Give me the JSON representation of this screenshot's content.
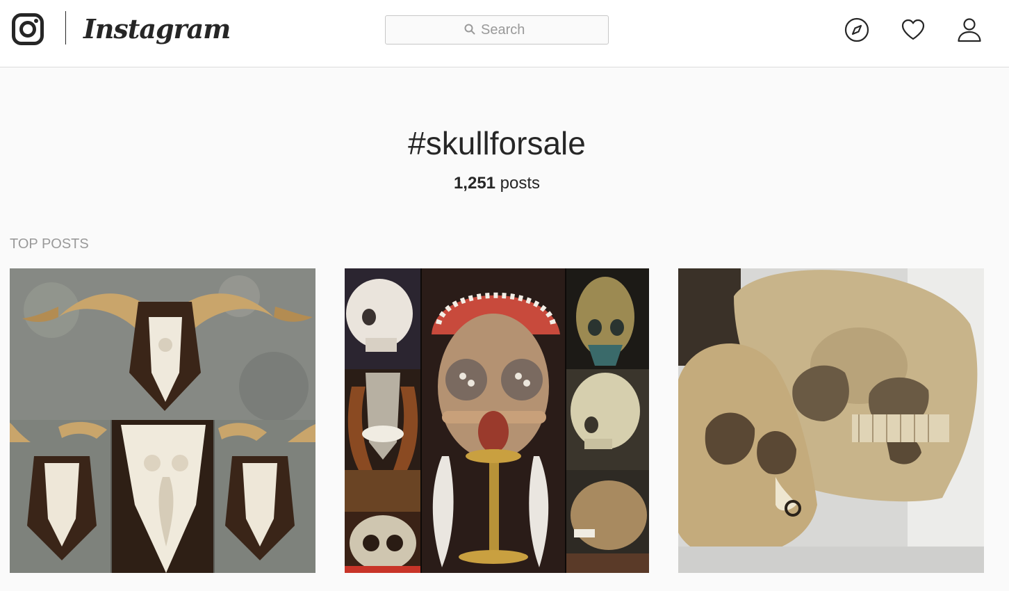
{
  "header": {
    "brand": {
      "wordmark": "Instagram",
      "glyph_icon": "camera-glyph-icon"
    },
    "search": {
      "placeholder": "Search",
      "value": "",
      "icon": "search-icon"
    },
    "nav": [
      {
        "name": "explore",
        "icon": "compass-icon"
      },
      {
        "name": "activity",
        "icon": "heart-icon"
      },
      {
        "name": "profile",
        "icon": "person-icon"
      }
    ]
  },
  "hashtag": {
    "title": "#skullforsale",
    "post_count": "1,251",
    "post_count_suffix": " posts"
  },
  "sections": {
    "top_posts_label": "TOP POSTS"
  },
  "posts": [
    {
      "image": "carved-ram-skull-collage"
    },
    {
      "image": "decorated-skulls-collage"
    },
    {
      "image": "human-and-primate-skulls-photo"
    }
  ],
  "colors": {
    "text": "#262626",
    "muted": "#999999",
    "border": "#dbdbdb",
    "background": "#fafafa"
  }
}
